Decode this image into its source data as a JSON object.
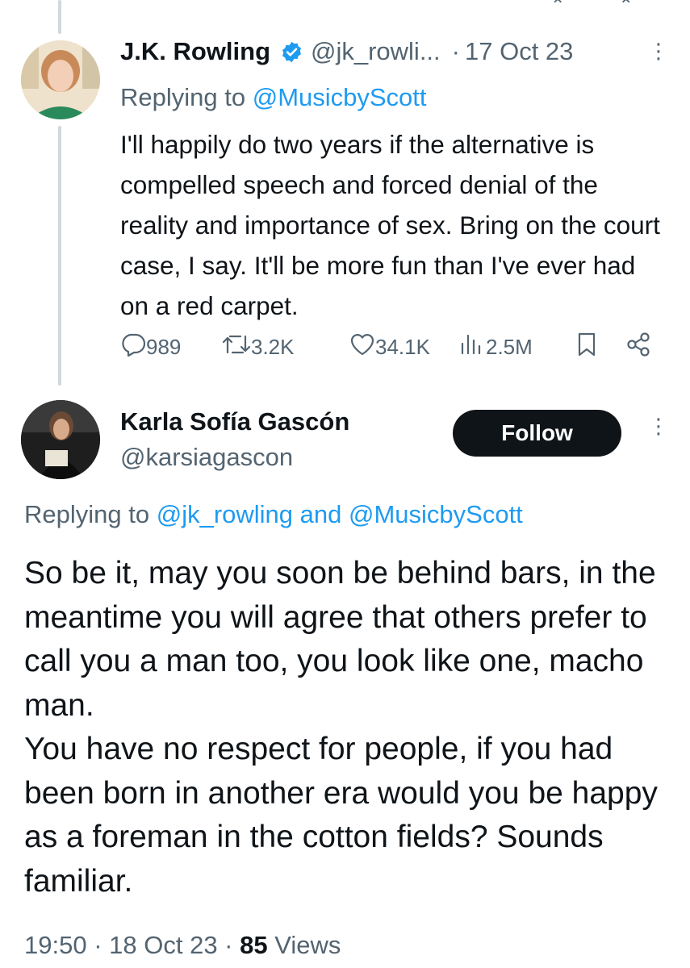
{
  "tweet_1": {
    "name": "J.K. Rowling",
    "handle": "@jk_rowli...",
    "separator": "·",
    "date": "17 Oct 23",
    "replying_prefix": "Replying to ",
    "replying_to": "@MusicbyScott",
    "text": "I'll happily do two years if the alternative is compelled speech and forced denial of the reality and importance of sex. Bring on the court case, I say. It'll be more fun than I've ever had on a red carpet.",
    "stats": {
      "replies": "989",
      "retweets": "3.2K",
      "likes": "34.1K",
      "views": "2.5M"
    }
  },
  "tweet_2": {
    "name": "Karla Sofía Gascón",
    "handle": "@karsiagascon",
    "follow_label": "Follow",
    "replying_prefix": "Replying to ",
    "replying_to_1": "@jk_rowling",
    "replying_and": " and ",
    "replying_to_2": "@MusicbyScott",
    "paragraph_1": "So be it, may you soon be behind bars, in the meantime you will agree that others prefer to call you a man too, you look like one, macho man.",
    "paragraph_2": "You have no respect for people, if you had been born in another era would you be happy as a foreman in the cotton fields? Sounds familiar.",
    "time": "19:50",
    "sep": " · ",
    "date": "18 Oct 23",
    "views_count": "85",
    "views_label": " Views"
  },
  "colors": {
    "accent": "#1d9bf0",
    "text": "#0f1419",
    "secondary": "#536471",
    "follow_bg": "#0f1419"
  },
  "icons": [
    "more-icon",
    "verified-badge-icon",
    "reply-icon",
    "retweet-icon",
    "like-icon",
    "views-icon",
    "bookmark-icon",
    "share-icon"
  ]
}
